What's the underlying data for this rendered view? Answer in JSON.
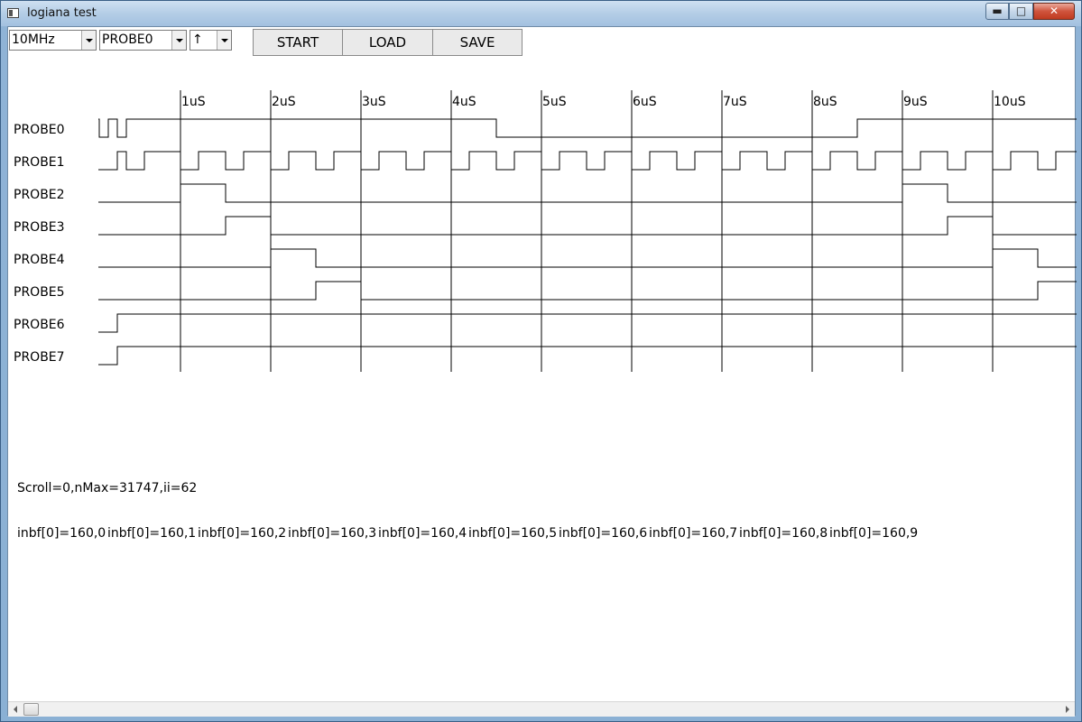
{
  "window": {
    "title": "logiana test",
    "min_label": "▬",
    "max_label": "□",
    "close_label": "✕"
  },
  "toolbar": {
    "freq_value": "10MHz",
    "probe_value": "PROBE0",
    "edge_value": "↑",
    "start_label": "START",
    "load_label": "LOAD",
    "save_label": "SAVE"
  },
  "timeline": {
    "ticks": [
      "1uS",
      "2uS",
      "3uS",
      "4uS",
      "5uS",
      "6uS",
      "7uS",
      "8uS",
      "9uS",
      "10uS"
    ],
    "probes": [
      "PROBE0",
      "PROBE1",
      "PROBE2",
      "PROBE3",
      "PROBE4",
      "PROBE5",
      "PROBE6",
      "PROBE7"
    ]
  },
  "waveforms": [
    {
      "name": "PROBE0",
      "initial": 1,
      "edges": [
        0.1,
        0.2,
        0.3,
        0.4,
        4.5,
        8.5
      ]
    },
    {
      "name": "PROBE1",
      "initial": 0,
      "edges": [
        0.3,
        0.4,
        0.6,
        1.0,
        1.2,
        1.5,
        1.7,
        2.0,
        2.2,
        2.5,
        2.7,
        3.0,
        3.2,
        3.5,
        3.7,
        4.0,
        4.2,
        4.5,
        4.7,
        5.0,
        5.2,
        5.5,
        5.7,
        6.0,
        6.2,
        6.5,
        6.7,
        7.0,
        7.2,
        7.5,
        7.7,
        8.0,
        8.2,
        8.5,
        8.7,
        9.0,
        9.2,
        9.5,
        9.7,
        10.0,
        10.2,
        10.5,
        10.7
      ]
    },
    {
      "name": "PROBE2",
      "initial": 0,
      "edges": [
        1.0,
        1.5,
        9.0,
        9.5
      ]
    },
    {
      "name": "PROBE3",
      "initial": 0,
      "edges": [
        1.5,
        2.0,
        9.5,
        10.0
      ]
    },
    {
      "name": "PROBE4",
      "initial": 0,
      "edges": [
        2.0,
        2.5,
        10.0,
        10.5
      ]
    },
    {
      "name": "PROBE5",
      "initial": 0,
      "edges": [
        2.5,
        3.0,
        10.5
      ]
    },
    {
      "name": "PROBE6",
      "initial": 0,
      "edges": [
        0.3
      ]
    },
    {
      "name": "PROBE7",
      "initial": 0,
      "edges": [
        0.3
      ]
    }
  ],
  "status_text": "Scroll=0,nMax=31747,ii=62",
  "inbf_values": [
    "inbf[0]=160,0",
    "inbf[0]=160,1",
    "inbf[0]=160,2",
    "inbf[0]=160,3",
    "inbf[0]=160,4",
    "inbf[0]=160,5",
    "inbf[0]=160,6",
    "inbf[0]=160,7",
    "inbf[0]=160,8",
    "inbf[0]=160,9"
  ],
  "scrollbar": {
    "position": 0
  }
}
